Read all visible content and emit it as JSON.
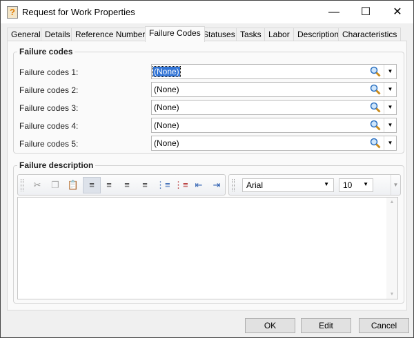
{
  "window": {
    "title": "Request for Work Properties"
  },
  "tabs": [
    "General",
    "Details",
    "Reference Numbers",
    "Failure Codes",
    "Statuses",
    "Tasks",
    "Labor",
    "Description",
    "Characteristics"
  ],
  "active_tab": "Failure Codes",
  "failure_codes": {
    "group_label": "Failure codes",
    "rows": [
      {
        "label": "Failure codes 1:",
        "value": "(None)"
      },
      {
        "label": "Failure codes 2:",
        "value": "(None)"
      },
      {
        "label": "Failure codes 3:",
        "value": "(None)"
      },
      {
        "label": "Failure codes 4:",
        "value": "(None)"
      },
      {
        "label": "Failure codes 5:",
        "value": "(None)"
      }
    ]
  },
  "failure_description": {
    "group_label": "Failure description",
    "font": "Arial",
    "size": "10",
    "text": ""
  },
  "buttons": {
    "ok": "OK",
    "edit": "Edit",
    "cancel": "Cancel"
  }
}
